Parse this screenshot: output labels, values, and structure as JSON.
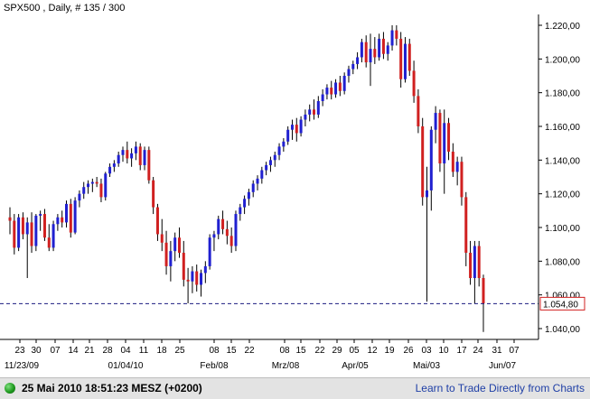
{
  "header": {
    "title": "SPX500 , Daily, # 135 / 300"
  },
  "price_marker": {
    "label": "1.054,80",
    "value": 1054.8,
    "color": "#d02020"
  },
  "colors": {
    "up": "#2020d0",
    "down": "#d02020",
    "dashed_line": "#1a1a80",
    "axis": "#000000"
  },
  "status_bar": {
    "datetime_text": "25 Mai 2010 18:51:23  MESZ (+0200)",
    "link_text": "Learn to Trade Directly from Charts",
    "indicator_icon": "green-circle-icon"
  },
  "chart_data": {
    "type": "candlestick",
    "title": "SPX500 , Daily, # 135 / 300",
    "y_tick_labels": [
      "1.040,00",
      "1.060,00",
      "1.080,00",
      "1.100,00",
      "1.120,00",
      "1.140,00",
      "1.160,00",
      "1.180,00",
      "1.200,00",
      "1.220,00"
    ],
    "y_ticks": [
      1040,
      1060,
      1080,
      1100,
      1120,
      1140,
      1160,
      1180,
      1200,
      1220
    ],
    "ylim": [
      1033,
      1226
    ],
    "x_day_labels": [
      "23",
      "30",
      "07",
      "14",
      "21",
      "28",
      "04",
      "11",
      "18",
      "25",
      "08",
      "15",
      "22",
      "08",
      "15",
      "22",
      "29",
      "05",
      "12",
      "19",
      "26",
      "03",
      "10",
      "17",
      "24",
      "31",
      "07"
    ],
    "x_month_labels": [
      "11/23/09",
      "01/04/10",
      "Feb/08",
      "Mrz/08",
      "Apr/05",
      "Mai/03",
      "Jun/07"
    ],
    "last_price": 1054.8,
    "candles": [
      {
        "o": 1106,
        "h": 1112,
        "l": 1096,
        "c": 1104
      },
      {
        "o": 1104,
        "h": 1108,
        "l": 1084,
        "c": 1088
      },
      {
        "o": 1088,
        "h": 1108,
        "l": 1086,
        "c": 1106
      },
      {
        "o": 1106,
        "h": 1109,
        "l": 1093,
        "c": 1096
      },
      {
        "o": 1096,
        "h": 1106,
        "l": 1070,
        "c": 1103
      },
      {
        "o": 1103,
        "h": 1109,
        "l": 1085,
        "c": 1089
      },
      {
        "o": 1089,
        "h": 1108,
        "l": 1086,
        "c": 1107
      },
      {
        "o": 1107,
        "h": 1110,
        "l": 1098,
        "c": 1108
      },
      {
        "o": 1108,
        "h": 1111,
        "l": 1092,
        "c": 1094
      },
      {
        "o": 1094,
        "h": 1102,
        "l": 1086,
        "c": 1088
      },
      {
        "o": 1088,
        "h": 1104,
        "l": 1086,
        "c": 1102
      },
      {
        "o": 1102,
        "h": 1108,
        "l": 1098,
        "c": 1106
      },
      {
        "o": 1106,
        "h": 1110,
        "l": 1100,
        "c": 1103
      },
      {
        "o": 1103,
        "h": 1116,
        "l": 1100,
        "c": 1114
      },
      {
        "o": 1114,
        "h": 1117,
        "l": 1094,
        "c": 1097
      },
      {
        "o": 1097,
        "h": 1118,
        "l": 1096,
        "c": 1116
      },
      {
        "o": 1116,
        "h": 1122,
        "l": 1112,
        "c": 1120
      },
      {
        "o": 1120,
        "h": 1127,
        "l": 1117,
        "c": 1124
      },
      {
        "o": 1124,
        "h": 1128,
        "l": 1120,
        "c": 1126
      },
      {
        "o": 1126,
        "h": 1129,
        "l": 1121,
        "c": 1127
      },
      {
        "o": 1127,
        "h": 1130,
        "l": 1124,
        "c": 1126
      },
      {
        "o": 1126,
        "h": 1129,
        "l": 1115,
        "c": 1118
      },
      {
        "o": 1118,
        "h": 1133,
        "l": 1116,
        "c": 1132
      },
      {
        "o": 1132,
        "h": 1138,
        "l": 1130,
        "c": 1136
      },
      {
        "o": 1136,
        "h": 1140,
        "l": 1133,
        "c": 1138
      },
      {
        "o": 1138,
        "h": 1145,
        "l": 1136,
        "c": 1143
      },
      {
        "o": 1143,
        "h": 1148,
        "l": 1139,
        "c": 1146
      },
      {
        "o": 1146,
        "h": 1151,
        "l": 1138,
        "c": 1141
      },
      {
        "o": 1141,
        "h": 1147,
        "l": 1136,
        "c": 1144
      },
      {
        "o": 1144,
        "h": 1151,
        "l": 1140,
        "c": 1148
      },
      {
        "o": 1148,
        "h": 1150,
        "l": 1134,
        "c": 1137
      },
      {
        "o": 1137,
        "h": 1148,
        "l": 1134,
        "c": 1146
      },
      {
        "o": 1146,
        "h": 1148,
        "l": 1126,
        "c": 1128
      },
      {
        "o": 1128,
        "h": 1130,
        "l": 1108,
        "c": 1112
      },
      {
        "o": 1112,
        "h": 1114,
        "l": 1092,
        "c": 1096
      },
      {
        "o": 1096,
        "h": 1105,
        "l": 1086,
        "c": 1091
      },
      {
        "o": 1091,
        "h": 1098,
        "l": 1072,
        "c": 1077
      },
      {
        "o": 1077,
        "h": 1092,
        "l": 1068,
        "c": 1086
      },
      {
        "o": 1086,
        "h": 1097,
        "l": 1080,
        "c": 1094
      },
      {
        "o": 1094,
        "h": 1100,
        "l": 1082,
        "c": 1085
      },
      {
        "o": 1085,
        "h": 1092,
        "l": 1065,
        "c": 1069
      },
      {
        "o": 1069,
        "h": 1076,
        "l": 1055,
        "c": 1068
      },
      {
        "o": 1068,
        "h": 1077,
        "l": 1061,
        "c": 1074
      },
      {
        "o": 1074,
        "h": 1078,
        "l": 1062,
        "c": 1066
      },
      {
        "o": 1066,
        "h": 1075,
        "l": 1059,
        "c": 1073
      },
      {
        "o": 1073,
        "h": 1080,
        "l": 1067,
        "c": 1077
      },
      {
        "o": 1077,
        "h": 1096,
        "l": 1075,
        "c": 1094
      },
      {
        "o": 1094,
        "h": 1098,
        "l": 1086,
        "c": 1096
      },
      {
        "o": 1096,
        "h": 1107,
        "l": 1093,
        "c": 1105
      },
      {
        "o": 1105,
        "h": 1110,
        "l": 1096,
        "c": 1099
      },
      {
        "o": 1099,
        "h": 1104,
        "l": 1090,
        "c": 1095
      },
      {
        "o": 1095,
        "h": 1100,
        "l": 1085,
        "c": 1089
      },
      {
        "o": 1089,
        "h": 1110,
        "l": 1086,
        "c": 1108
      },
      {
        "o": 1108,
        "h": 1114,
        "l": 1104,
        "c": 1112
      },
      {
        "o": 1112,
        "h": 1119,
        "l": 1108,
        "c": 1117
      },
      {
        "o": 1117,
        "h": 1123,
        "l": 1113,
        "c": 1121
      },
      {
        "o": 1121,
        "h": 1128,
        "l": 1118,
        "c": 1126
      },
      {
        "o": 1126,
        "h": 1131,
        "l": 1122,
        "c": 1129
      },
      {
        "o": 1129,
        "h": 1136,
        "l": 1126,
        "c": 1134
      },
      {
        "o": 1134,
        "h": 1139,
        "l": 1131,
        "c": 1137
      },
      {
        "o": 1137,
        "h": 1142,
        "l": 1133,
        "c": 1140
      },
      {
        "o": 1140,
        "h": 1145,
        "l": 1136,
        "c": 1143
      },
      {
        "o": 1143,
        "h": 1150,
        "l": 1140,
        "c": 1148
      },
      {
        "o": 1148,
        "h": 1153,
        "l": 1145,
        "c": 1151
      },
      {
        "o": 1151,
        "h": 1160,
        "l": 1149,
        "c": 1158
      },
      {
        "o": 1158,
        "h": 1164,
        "l": 1152,
        "c": 1161
      },
      {
        "o": 1161,
        "h": 1165,
        "l": 1151,
        "c": 1156
      },
      {
        "o": 1156,
        "h": 1166,
        "l": 1154,
        "c": 1164
      },
      {
        "o": 1164,
        "h": 1170,
        "l": 1160,
        "c": 1167
      },
      {
        "o": 1167,
        "h": 1173,
        "l": 1163,
        "c": 1170
      },
      {
        "o": 1170,
        "h": 1176,
        "l": 1164,
        "c": 1167
      },
      {
        "o": 1167,
        "h": 1178,
        "l": 1165,
        "c": 1175
      },
      {
        "o": 1175,
        "h": 1182,
        "l": 1172,
        "c": 1179
      },
      {
        "o": 1179,
        "h": 1185,
        "l": 1176,
        "c": 1183
      },
      {
        "o": 1183,
        "h": 1187,
        "l": 1176,
        "c": 1179
      },
      {
        "o": 1179,
        "h": 1188,
        "l": 1177,
        "c": 1186
      },
      {
        "o": 1186,
        "h": 1190,
        "l": 1178,
        "c": 1181
      },
      {
        "o": 1181,
        "h": 1192,
        "l": 1179,
        "c": 1190
      },
      {
        "o": 1190,
        "h": 1196,
        "l": 1186,
        "c": 1194
      },
      {
        "o": 1194,
        "h": 1199,
        "l": 1191,
        "c": 1197
      },
      {
        "o": 1197,
        "h": 1204,
        "l": 1194,
        "c": 1201
      },
      {
        "o": 1201,
        "h": 1212,
        "l": 1198,
        "c": 1210
      },
      {
        "o": 1210,
        "h": 1214,
        "l": 1195,
        "c": 1198
      },
      {
        "o": 1198,
        "h": 1215,
        "l": 1184,
        "c": 1206
      },
      {
        "o": 1206,
        "h": 1213,
        "l": 1197,
        "c": 1201
      },
      {
        "o": 1201,
        "h": 1215,
        "l": 1199,
        "c": 1212
      },
      {
        "o": 1212,
        "h": 1216,
        "l": 1200,
        "c": 1203
      },
      {
        "o": 1203,
        "h": 1210,
        "l": 1199,
        "c": 1208
      },
      {
        "o": 1208,
        "h": 1220,
        "l": 1205,
        "c": 1217
      },
      {
        "o": 1217,
        "h": 1220,
        "l": 1208,
        "c": 1212
      },
      {
        "o": 1212,
        "h": 1216,
        "l": 1183,
        "c": 1188
      },
      {
        "o": 1188,
        "h": 1213,
        "l": 1186,
        "c": 1209
      },
      {
        "o": 1209,
        "h": 1212,
        "l": 1190,
        "c": 1193
      },
      {
        "o": 1193,
        "h": 1199,
        "l": 1174,
        "c": 1178
      },
      {
        "o": 1178,
        "h": 1182,
        "l": 1156,
        "c": 1160
      },
      {
        "o": 1160,
        "h": 1165,
        "l": 1113,
        "c": 1118
      },
      {
        "o": 1118,
        "h": 1136,
        "l": 1056,
        "c": 1122
      },
      {
        "o": 1122,
        "h": 1160,
        "l": 1110,
        "c": 1158
      },
      {
        "o": 1158,
        "h": 1172,
        "l": 1150,
        "c": 1168
      },
      {
        "o": 1168,
        "h": 1170,
        "l": 1133,
        "c": 1138
      },
      {
        "o": 1138,
        "h": 1170,
        "l": 1120,
        "c": 1162
      },
      {
        "o": 1162,
        "h": 1165,
        "l": 1140,
        "c": 1145
      },
      {
        "o": 1145,
        "h": 1150,
        "l": 1130,
        "c": 1133
      },
      {
        "o": 1133,
        "h": 1142,
        "l": 1125,
        "c": 1139
      },
      {
        "o": 1139,
        "h": 1142,
        "l": 1113,
        "c": 1118
      },
      {
        "o": 1118,
        "h": 1121,
        "l": 1077,
        "c": 1085
      },
      {
        "o": 1085,
        "h": 1092,
        "l": 1066,
        "c": 1070
      },
      {
        "o": 1070,
        "h": 1092,
        "l": 1055,
        "c": 1089
      },
      {
        "o": 1089,
        "h": 1092,
        "l": 1065,
        "c": 1070
      },
      {
        "o": 1070,
        "h": 1072,
        "l": 1038,
        "c": 1055
      }
    ]
  }
}
